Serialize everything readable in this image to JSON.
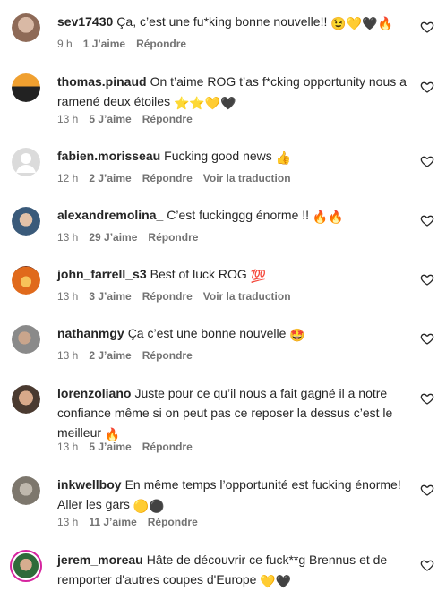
{
  "comments": [
    {
      "user": "sev17430",
      "text": "Ça, c’est une fu*king bonne nouvelle!! ",
      "emoji": "😉💛🖤🔥",
      "time": "9 h",
      "likes": "1 J’aime",
      "reply": "Répondre",
      "translate": ""
    },
    {
      "user": "thomas.pinaud",
      "text": "On t’aime ROG t’as f*cking opportunity nous a ramené deux étoiles ",
      "emoji": "⭐️⭐️💛🖤",
      "time": "13 h",
      "likes": "5 J’aime",
      "reply": "Répondre",
      "translate": ""
    },
    {
      "user": "fabien.morisseau",
      "text": "Fucking good news ",
      "emoji": "👍",
      "time": "12 h",
      "likes": "2 J’aime",
      "reply": "Répondre",
      "translate": "Voir la traduction"
    },
    {
      "user": "alexandremolina_",
      "text": "C’est fuckinggg énorme !! ",
      "emoji": "🔥🔥",
      "time": "13 h",
      "likes": "29 J’aime",
      "reply": "Répondre",
      "translate": ""
    },
    {
      "user": "john_farrell_s3",
      "text": "Best of luck ROG ",
      "emoji": "💯",
      "time": "13 h",
      "likes": "3 J’aime",
      "reply": "Répondre",
      "translate": "Voir la traduction"
    },
    {
      "user": "nathanmgy",
      "text": "Ça c’est une bonne nouvelle ",
      "emoji": "🤩",
      "time": "13 h",
      "likes": "2 J’aime",
      "reply": "Répondre",
      "translate": ""
    },
    {
      "user": "lorenzoliano",
      "text": "Juste pour ce qu’il nous a fait gagné il a notre confiance même si on peut pas ce reposer la dessus c’est le meilleur ",
      "emoji": "🔥",
      "time": "13 h",
      "likes": "5 J’aime",
      "reply": "Répondre",
      "translate": ""
    },
    {
      "user": "inkwellboy",
      "text": "En même temps l’opportunité est fucking énorme! Aller les gars ",
      "emoji": "🟡⚫",
      "time": "13 h",
      "likes": "11 J’aime",
      "reply": "Répondre",
      "translate": ""
    },
    {
      "user": "jerem_moreau",
      "text": "Hâte de découvrir ce fuck**g Brennus et de remporter d'autres coupes d'Europe ",
      "emoji": "💛🖤",
      "time": "",
      "likes": "",
      "reply": "",
      "translate": ""
    }
  ],
  "colors": {
    "meta": "#737373",
    "text": "#262626"
  },
  "icons": {
    "like": "heart-outline-icon"
  }
}
